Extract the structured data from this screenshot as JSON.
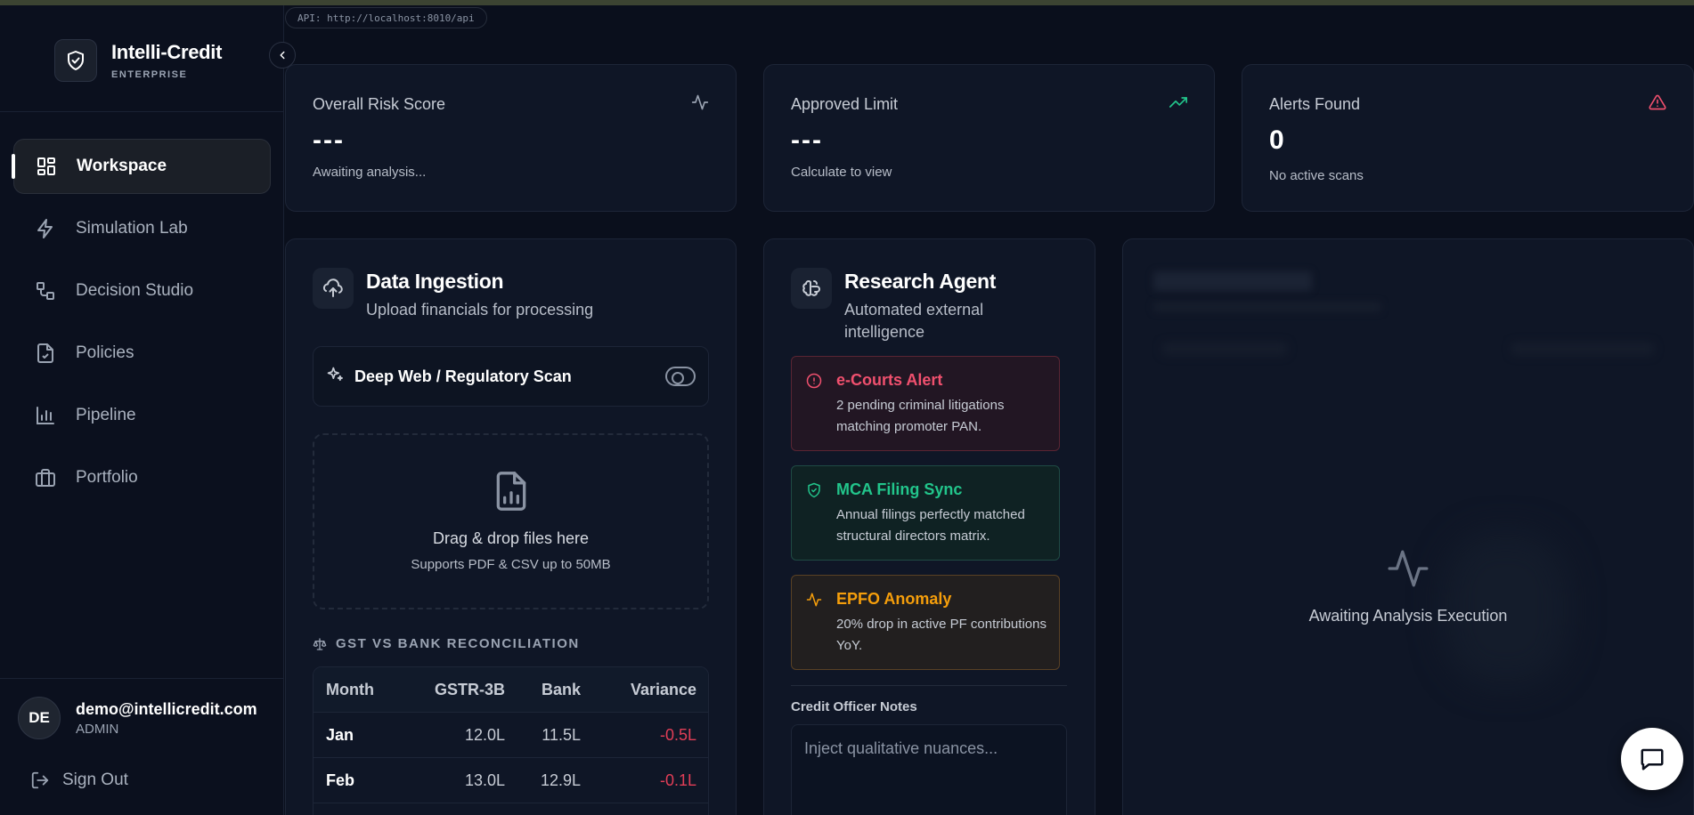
{
  "api": {
    "label": "API: http://localhost:8010/api"
  },
  "brand": {
    "name": "Intelli-Credit",
    "tier": "ENTERPRISE"
  },
  "sidebar": {
    "items": [
      {
        "label": "Workspace",
        "icon": "grid-icon",
        "active": true
      },
      {
        "label": "Simulation Lab",
        "icon": "lightning-icon",
        "active": false
      },
      {
        "label": "Decision Studio",
        "icon": "workflow-icon",
        "active": false
      },
      {
        "label": "Policies",
        "icon": "document-check-icon",
        "active": false
      },
      {
        "label": "Pipeline",
        "icon": "bar-chart-icon",
        "active": false
      },
      {
        "label": "Portfolio",
        "icon": "briefcase-icon",
        "active": false
      }
    ]
  },
  "user": {
    "initials": "DE",
    "email": "demo@intellicredit.com",
    "role": "ADMIN"
  },
  "signout": {
    "label": "Sign Out"
  },
  "stats": [
    {
      "title": "Overall Risk Score",
      "value": "---",
      "sub": "Awaiting analysis...",
      "icon": "activity-icon",
      "color": "#9aa3b2"
    },
    {
      "title": "Approved Limit",
      "value": "---",
      "sub": "Calculate to view",
      "icon": "trending-up-icon",
      "color": "#22c58b"
    },
    {
      "title": "Alerts Found",
      "value": "0",
      "sub": "No active scans",
      "icon": "alert-triangle-icon",
      "color": "#f0506e"
    }
  ],
  "ingestion": {
    "title": "Data Ingestion",
    "subtitle": "Upload financials for processing",
    "scan_label": "Deep Web / Regulatory Scan",
    "scan_enabled": false,
    "drop_title": "Drag & drop files here",
    "drop_sub": "Supports PDF & CSV up to 50MB",
    "recon_title": "GST VS BANK RECONCILIATION",
    "recon_headers": [
      "Month",
      "GSTR-3B",
      "Bank",
      "Variance"
    ],
    "recon_rows": [
      [
        "Jan",
        "12.0L",
        "11.5L",
        "-0.5L"
      ],
      [
        "Feb",
        "13.0L",
        "12.9L",
        "-0.1L"
      ],
      [
        "",
        "",
        "",
        ""
      ]
    ]
  },
  "research": {
    "title": "Research Agent",
    "subtitle": "Automated external intelligence",
    "alerts": [
      {
        "title": "e-Courts Alert",
        "text": "2 pending criminal litigations matching promoter PAN.",
        "tone": "red",
        "icon": "alert-circle-icon"
      },
      {
        "title": "MCA Filing Sync",
        "text": "Annual filings perfectly matched structural directors matrix.",
        "tone": "green",
        "icon": "shield-check-icon"
      },
      {
        "title": "EPFO Anomaly",
        "text": "20% drop in active PF contributions YoY.",
        "tone": "amber",
        "icon": "activity-icon"
      }
    ],
    "notes_label": "Credit Officer Notes",
    "notes_placeholder": "Inject qualitative nuances..."
  },
  "analysis": {
    "waiting_text": "Awaiting Analysis Execution"
  },
  "colors": {
    "red": "#f0506e",
    "green": "#22c58b",
    "amber": "#f59e0b",
    "background": "#0a0f1c"
  }
}
